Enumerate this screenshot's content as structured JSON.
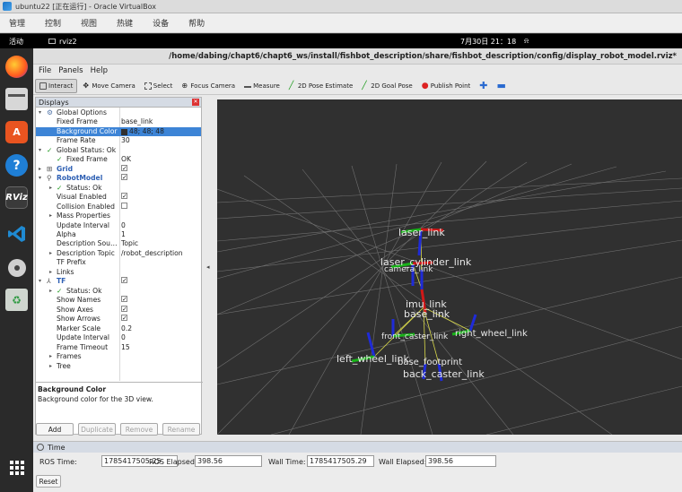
{
  "host": {
    "title": "ubuntu22 [正在运行] - Oracle VirtualBox",
    "menu": [
      "管理",
      "控制",
      "视图",
      "热键",
      "设备",
      "帮助"
    ]
  },
  "ubuntu": {
    "activities": "活动",
    "app": "rviz2",
    "clock": "7月30日  21：18"
  },
  "dock": {
    "items": [
      "firefox-icon",
      "files-icon",
      "app-center-icon",
      "help-icon",
      "rviz-icon",
      "vscode-icon",
      "disc-icon",
      "trash-icon"
    ],
    "rviz_label": "RViz",
    "apps_grid": "show-apps-icon"
  },
  "rviz": {
    "title": "/home/dabing/chapt6/chapt6_ws/install/fishbot_description/share/fishbot_description/config/display_robot_model.rviz*",
    "menu": {
      "file": "File",
      "panels": "Panels",
      "help": "Help"
    },
    "toolbar": {
      "interact": "Interact",
      "move_camera": "Move Camera",
      "select": "Select",
      "focus_camera": "Focus Camera",
      "measure": "Measure",
      "pose_estimate": "2D Pose Estimate",
      "goal_pose": "2D Goal Pose",
      "publish_point": "Publish Point"
    },
    "displays": {
      "header": "Displays",
      "rows": [
        {
          "k": "Global Options",
          "v": ""
        },
        {
          "k": "Fixed Frame",
          "v": "base_link"
        },
        {
          "k": "Background Color",
          "v": "48; 48; 48"
        },
        {
          "k": "Frame Rate",
          "v": "30"
        },
        {
          "k": "Global Status: Ok",
          "v": ""
        },
        {
          "k": "Fixed Frame",
          "v": "OK"
        },
        {
          "k": "Grid",
          "v": ""
        },
        {
          "k": "RobotModel",
          "v": ""
        },
        {
          "k": "Status: Ok",
          "v": ""
        },
        {
          "k": "Visual Enabled",
          "v": ""
        },
        {
          "k": "Collision Enabled",
          "v": ""
        },
        {
          "k": "Mass Properties",
          "v": ""
        },
        {
          "k": "Update Interval",
          "v": "0"
        },
        {
          "k": "Alpha",
          "v": "1"
        },
        {
          "k": "Description Sou…",
          "v": "Topic"
        },
        {
          "k": "Description Topic",
          "v": "/robot_description"
        },
        {
          "k": "TF Prefix",
          "v": ""
        },
        {
          "k": "Links",
          "v": ""
        },
        {
          "k": "TF",
          "v": ""
        },
        {
          "k": "Status: Ok",
          "v": ""
        },
        {
          "k": "Show Names",
          "v": ""
        },
        {
          "k": "Show Axes",
          "v": ""
        },
        {
          "k": "Show Arrows",
          "v": ""
        },
        {
          "k": "Marker Scale",
          "v": "0.2"
        },
        {
          "k": "Update Interval",
          "v": "0"
        },
        {
          "k": "Frame Timeout",
          "v": "15"
        },
        {
          "k": "Frames",
          "v": ""
        },
        {
          "k": "Tree",
          "v": ""
        }
      ],
      "desc_title": "Background Color",
      "desc_text": "Background color for the 3D view.",
      "buttons": {
        "add": "Add",
        "duplicate": "Duplicate",
        "remove": "Remove",
        "rename": "Rename"
      }
    },
    "scene": {
      "background": "#303030",
      "labels": {
        "laser_link": "laser_link",
        "laser_cylinder_link": "laser_cylinder_link",
        "camera_link": "camera_link",
        "imu_link": "imu_link",
        "base_link": "base_link",
        "front_caster_link": "front_caster_link",
        "right_wheel_link": "right_wheel_link",
        "left_wheel_link": "left_wheel_link",
        "base_footprint": "base_footprint",
        "back_caster_link": "back_caster_link"
      }
    },
    "time": {
      "header": "Time",
      "ros_time_label": "ROS Time:",
      "ros_time": "1785417505.25",
      "ros_elapsed_label": "ROS Elapsed:",
      "ros_elapsed": "398.56",
      "wall_time_label": "Wall Time:",
      "wall_time": "1785417505.29",
      "wall_elapsed_label": "Wall Elapsed:",
      "wall_elapsed": "398.56",
      "reset": "Reset"
    }
  }
}
